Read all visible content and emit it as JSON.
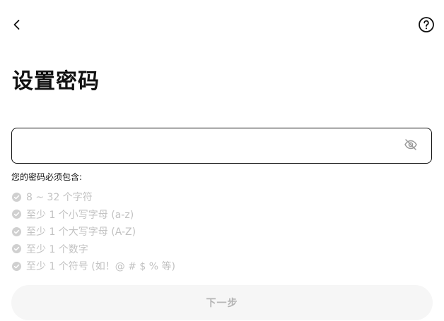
{
  "header": {
    "back_icon": "chevron-left-icon",
    "help_icon": "question-circle-icon"
  },
  "page": {
    "title": "设置密码"
  },
  "password": {
    "value": "",
    "placeholder": "",
    "visibility_icon": "eye-off-icon"
  },
  "requirements": {
    "heading": "您的密码必须包含:",
    "check_icon": "check-circle-icon",
    "check_color": "#d0d0d0",
    "items": [
      {
        "label": "8 ~ 32 个字符"
      },
      {
        "label": "至少 1 个小写字母 (a-z)"
      },
      {
        "label": "至少 1 个大写字母 (A-Z)"
      },
      {
        "label": "至少 1 个数字"
      },
      {
        "label": "至少 1 个符号 (如！@ # $ % 等)"
      }
    ]
  },
  "footer": {
    "next_label": "下一步",
    "next_bg": "#f6f6f6",
    "next_text_color": "#b4b4b4"
  }
}
